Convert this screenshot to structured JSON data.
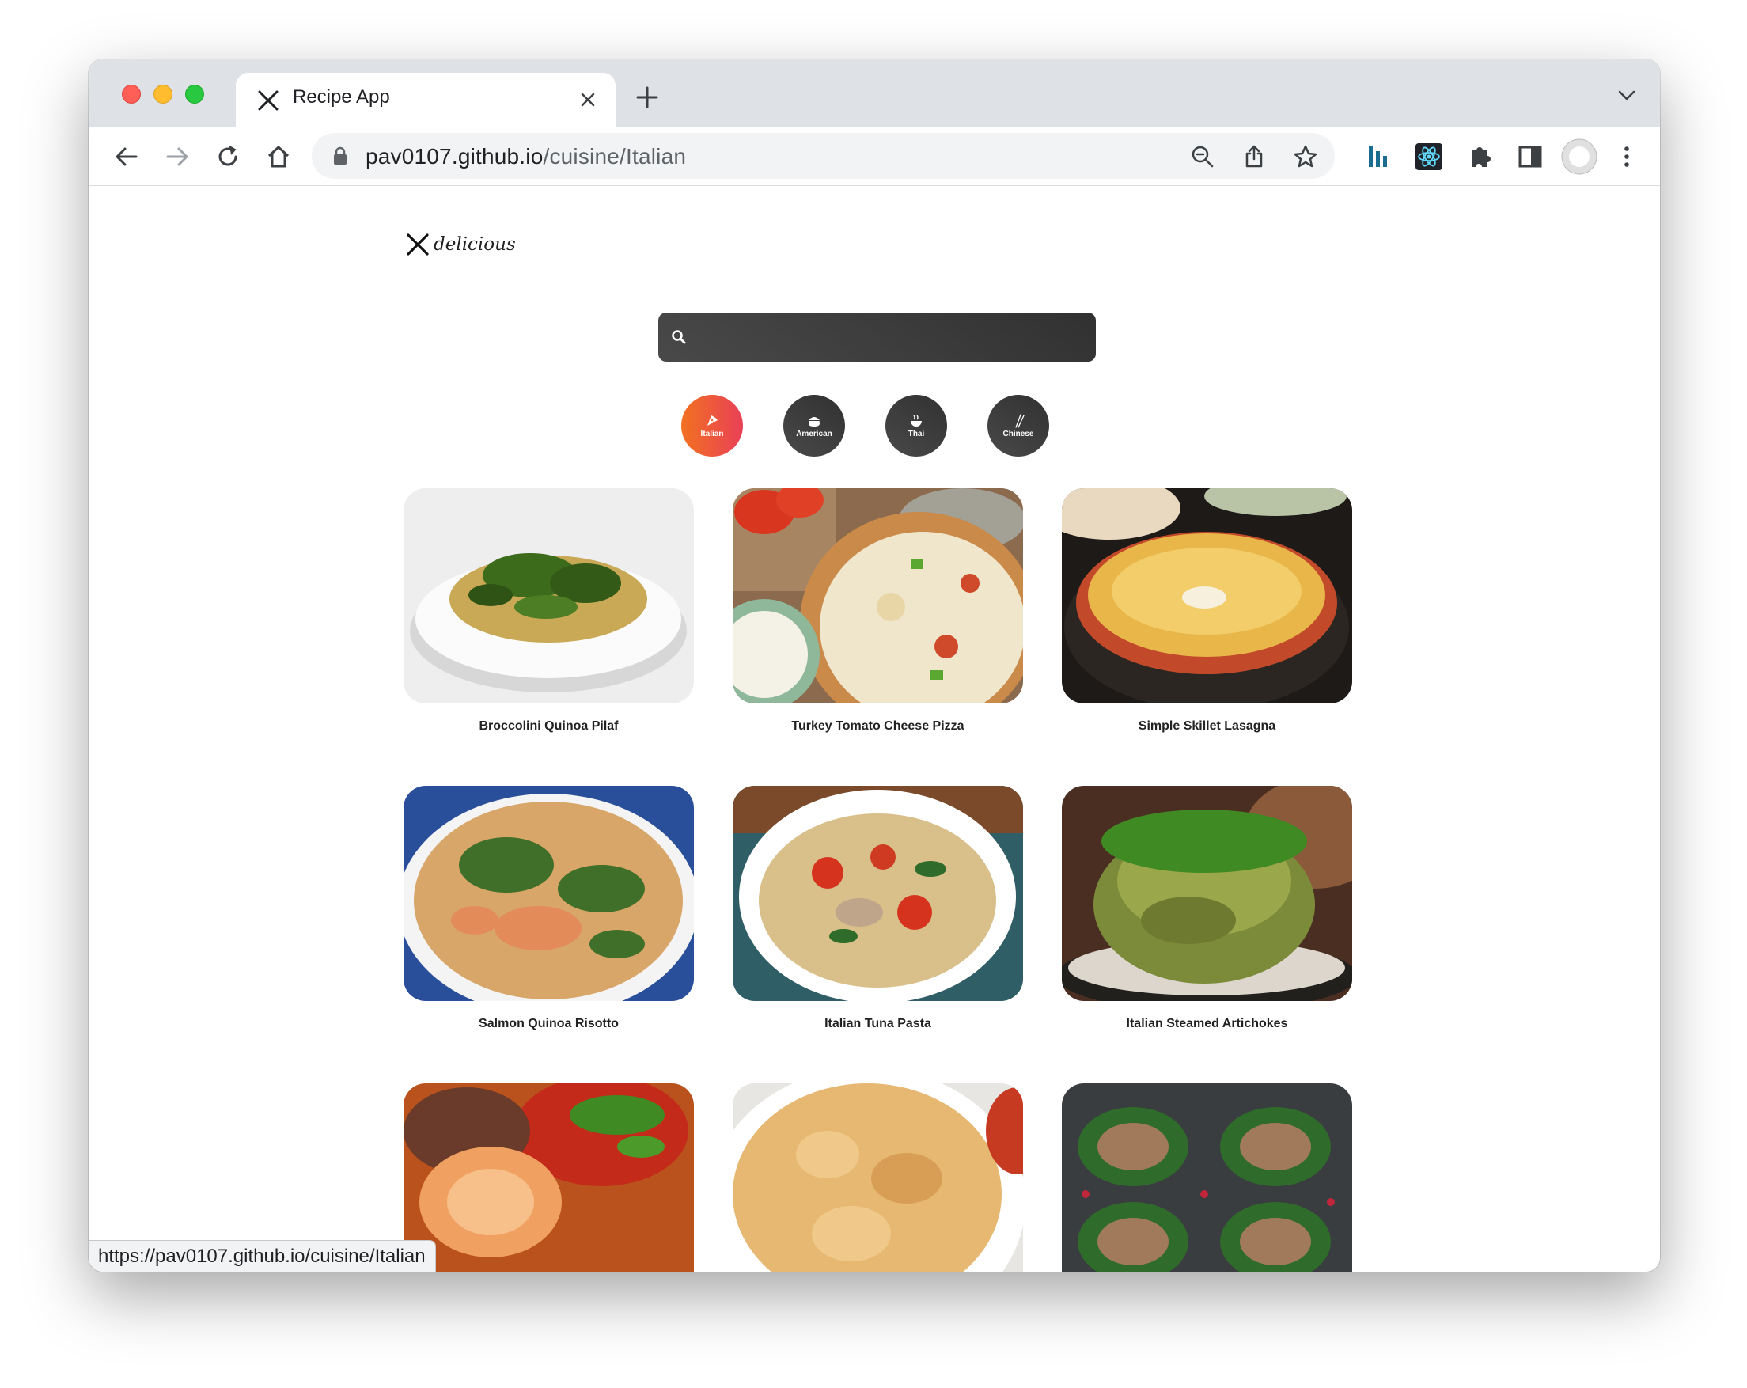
{
  "browser": {
    "tab_title": "Recipe App",
    "url_host": "pav0107.github.io",
    "url_path": "/cuisine/Italian",
    "status_url": "https://pav0107.github.io/cuisine/Italian"
  },
  "app": {
    "logo_text": "delicious",
    "search_placeholder": "",
    "cuisines": [
      {
        "label": "Italian",
        "icon": "pizza-icon",
        "active": true
      },
      {
        "label": "American",
        "icon": "hamburger-icon",
        "active": false
      },
      {
        "label": "Thai",
        "icon": "noodle-bowl-icon",
        "active": false
      },
      {
        "label": "Chinese",
        "icon": "chopsticks-icon",
        "active": false
      }
    ],
    "recipes": [
      {
        "title": "Broccolini Quinoa Pilaf"
      },
      {
        "title": "Turkey Tomato Cheese Pizza"
      },
      {
        "title": "Simple Skillet Lasagna"
      },
      {
        "title": "Salmon Quinoa Risotto"
      },
      {
        "title": "Italian Tuna Pasta"
      },
      {
        "title": "Italian Steamed Artichokes"
      },
      {
        "title": ""
      },
      {
        "title": ""
      },
      {
        "title": ""
      }
    ]
  },
  "colors": {
    "active_start": "#f27121",
    "active_end": "#e94057",
    "dark_start": "#494949",
    "dark_end": "#313131"
  }
}
